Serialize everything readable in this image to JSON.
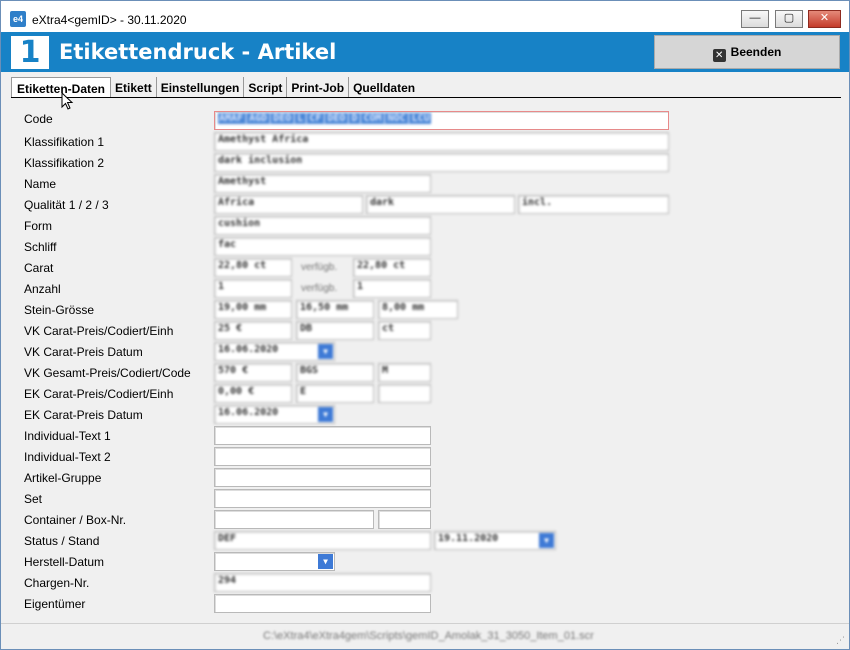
{
  "window": {
    "title": "eXtra4<gemID>  -  30.11.2020",
    "app_icon": "e4",
    "min_label": "—",
    "max_label": "▢",
    "close_label": "✕"
  },
  "header": {
    "badge": "1",
    "title": "Etikettendruck - Artikel",
    "exit_label": "Beenden",
    "exit_icon": "✕",
    "accent_color": "#1782c6"
  },
  "tabs": [
    {
      "label": "Etiketten-Daten",
      "active": true
    },
    {
      "label": "Etikett",
      "active": false
    },
    {
      "label": "Einstellungen",
      "active": false
    },
    {
      "label": "Script",
      "active": false
    },
    {
      "label": "Print-Job",
      "active": false
    },
    {
      "label": "Quelldaten",
      "active": false
    }
  ],
  "form": {
    "labels": {
      "code": "Code",
      "klass1": "Klassifikation 1",
      "klass2": "Klassifikation 2",
      "name": "Name",
      "qualitaet": "Qualität 1 / 2 / 3",
      "form": "Form",
      "schliff": "Schliff",
      "carat": "Carat",
      "anzahl": "Anzahl",
      "groesse": "Stein-Grösse",
      "vk_carat_preis": "VK Carat-Preis/Codiert/Einh",
      "vk_carat_datum": "VK Carat-Preis Datum",
      "vk_gesamt": "VK Gesamt-Preis/Codiert/Code",
      "ek_carat_preis": "EK Carat-Preis/Codiert/Einh",
      "ek_carat_datum": "EK Carat-Preis Datum",
      "ind1": "Individual-Text 1",
      "ind2": "Individual-Text 2",
      "gruppe": "Artikel-Gruppe",
      "set": "Set",
      "container": "Container / Box-Nr.",
      "status": "Status / Stand",
      "herstell": "Herstell-Datum",
      "chargen": "Chargen-Nr.",
      "eigentuemer": "Eigentümer"
    },
    "values": {
      "code": "AMAF|AGD|DEO|L|CF|DEO|D|COM|NOC|LCU",
      "klass1": "Amethyst Africa",
      "klass2": "dark inclusion",
      "name": "Amethyst",
      "qual1": "Africa",
      "qual2": "dark",
      "qual3": "incl.",
      "form": "cushion",
      "schliff": "fac",
      "carat": "22,80 ct",
      "carat_verf": "22,80 ct",
      "anzahl": "1",
      "anzahl_verf": "1",
      "gr1": "19,00 mm",
      "gr2": "16,50 mm",
      "gr3": "8,00 mm",
      "vkc1": "25 €",
      "vkc2": "DB",
      "vkc3": "ct",
      "vk_datum": "16.06.2020",
      "vkg1": "570 €",
      "vkg2": "BGS",
      "vkg3": "M",
      "ekc1": "0,00 €",
      "ekc2": "E",
      "ekc3": "",
      "ek_datum": "16.06.2020",
      "ind1": "",
      "ind2": "",
      "gruppe": "",
      "set": "",
      "container1": "",
      "container2": "",
      "status": "DEF",
      "stand": "19.11.2020",
      "herstell": "",
      "chargen": "294",
      "eigentuemer": ""
    },
    "verfuegbar_label": "verfügb."
  },
  "status_path": "C:\\eXtra4\\eXtra4gem\\Scripts\\gemID_Amolak_31_3050_Item_01.scr",
  "grip": "⋰"
}
